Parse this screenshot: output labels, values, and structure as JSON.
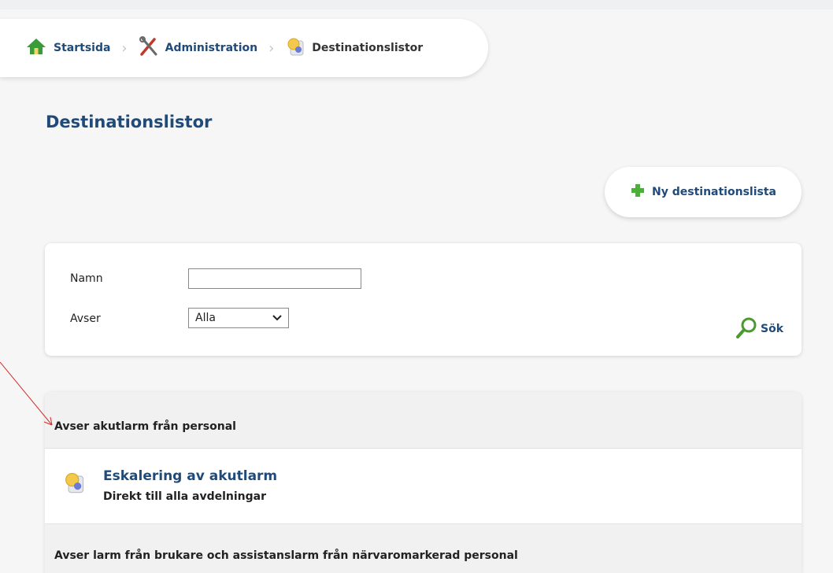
{
  "breadcrumb": {
    "items": [
      {
        "label": "Startsida",
        "icon": "home-icon"
      },
      {
        "label": "Administration",
        "icon": "tools-icon"
      },
      {
        "label": "Destinationslistor",
        "icon": "destination-list-icon"
      }
    ]
  },
  "page": {
    "title": "Destinationslistor"
  },
  "new_button": {
    "label": "Ny destinationslista",
    "icon": "plus-icon"
  },
  "search": {
    "name_label": "Namn",
    "name_value": "",
    "avser_label": "Avser",
    "avser_selected": "Alla",
    "search_button_label": "Sök"
  },
  "list": {
    "groups": [
      {
        "header": "Avser akutlarm från personal",
        "items": [
          {
            "title": "Eskalering av akutlarm",
            "subtitle": "Direkt till alla avdelningar"
          }
        ]
      },
      {
        "header": "Avser larm från brukare och assistanslarm från närvaromarkerad personal",
        "items": []
      }
    ]
  },
  "colors": {
    "link": "#1f4a79",
    "home_green": "#3a9b3a",
    "plus_green": "#4caf3a",
    "annotation": "#d22a2a"
  }
}
